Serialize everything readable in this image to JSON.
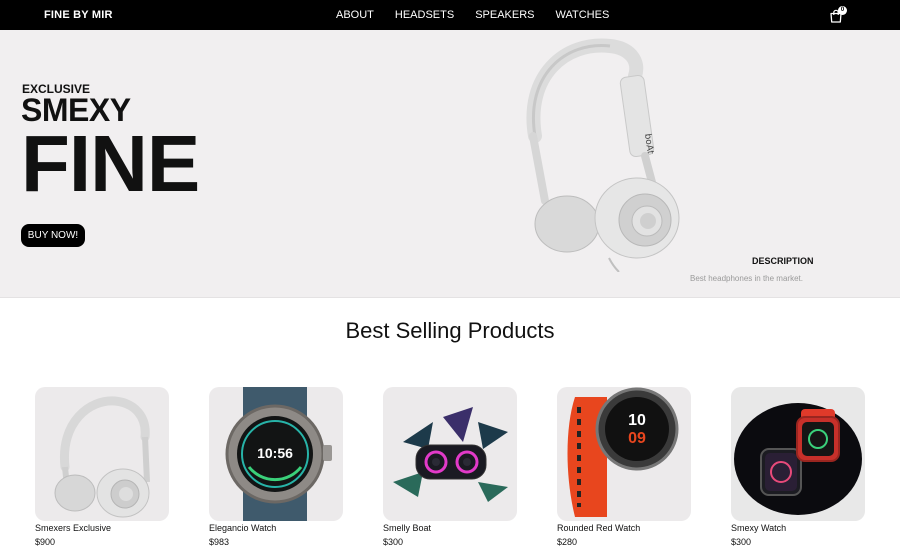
{
  "navbar": {
    "brand": "FINE BY MIR",
    "links": [
      "ABOUT",
      "HEADSETS",
      "SPEAKERS",
      "WATCHES"
    ],
    "cart_icon": "shopping-bag-icon",
    "cart_count": "0"
  },
  "hero": {
    "eyebrow": "EXCLUSIVE",
    "line1": "SMEXY",
    "line2": "FINE",
    "button": "BUY NOW!",
    "image": "white-headphones",
    "description_title": "DESCRIPTION",
    "description_text": "Best headphones in the market."
  },
  "best_selling": {
    "title": "Best Selling Products",
    "products": [
      {
        "name": "Smexers Exclusive",
        "price": "$900",
        "image": "white-headphones"
      },
      {
        "name": "Elegancio Watch",
        "price": "$983",
        "image": "blue-smartwatch"
      },
      {
        "name": "Smelly Boat",
        "price": "$300",
        "image": "bluetooth-speaker"
      },
      {
        "name": "Rounded Red Watch",
        "price": "$280",
        "image": "red-watch"
      },
      {
        "name": "Smexy Watch",
        "price": "$300",
        "image": "red-smartwatch"
      }
    ]
  },
  "colors": {
    "navbar_bg": "#000000",
    "hero_bg": "#f1eff0",
    "card_bg": "#eceaeb",
    "accent_red": "#e8461e"
  }
}
